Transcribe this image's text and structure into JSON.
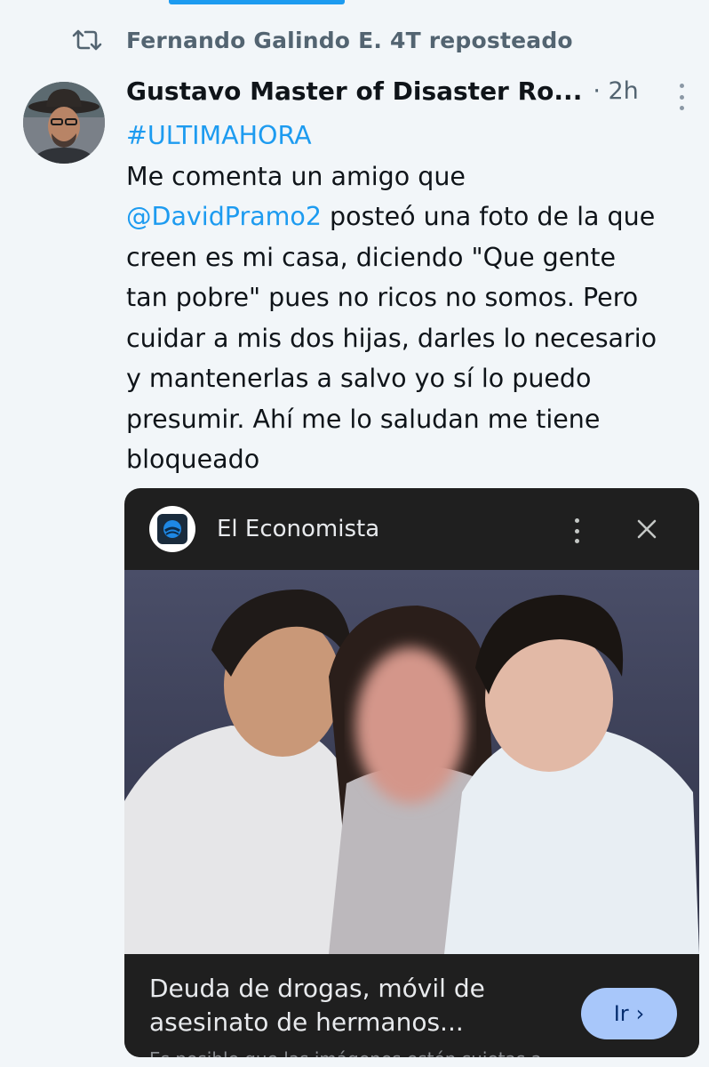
{
  "repost": {
    "text": "Fernando Galindo E. 4T reposteado",
    "icon": "repost-icon"
  },
  "tweet": {
    "display_name": "Gustavo Master of Disaster Ro...",
    "time": "· 2h",
    "hashtag": "#ULTIMAHORA",
    "line1": "Me comenta un amigo que",
    "mention": "@DavidPramo2",
    "line2_rest": " posteó una foto de la que",
    "line3": "creen es mi casa, diciendo \"Que gente",
    "line4": "tan pobre\" pues no ricos no somos. Pero",
    "line5": "cuidar a mis dos hijas, darles lo necesario",
    "line6": "y mantenerlas a salvo yo sí lo puedo",
    "line7": "presumir. Ahí me lo saludan me tiene",
    "line8": "bloqueado"
  },
  "card": {
    "source_name": "El Economista",
    "headline_line1": "Deuda de drogas, móvil de",
    "headline_line2": "asesinato de hermanos...",
    "go_label": "Ir",
    "go_chevron": "›",
    "subtext": "Es posible que las imágenes estén sujetas a..."
  },
  "colors": {
    "accent": "#1d9bf0",
    "secondary_text": "#536471",
    "card_bg": "#1f1f1f",
    "go_button": "#a8c7fa"
  }
}
